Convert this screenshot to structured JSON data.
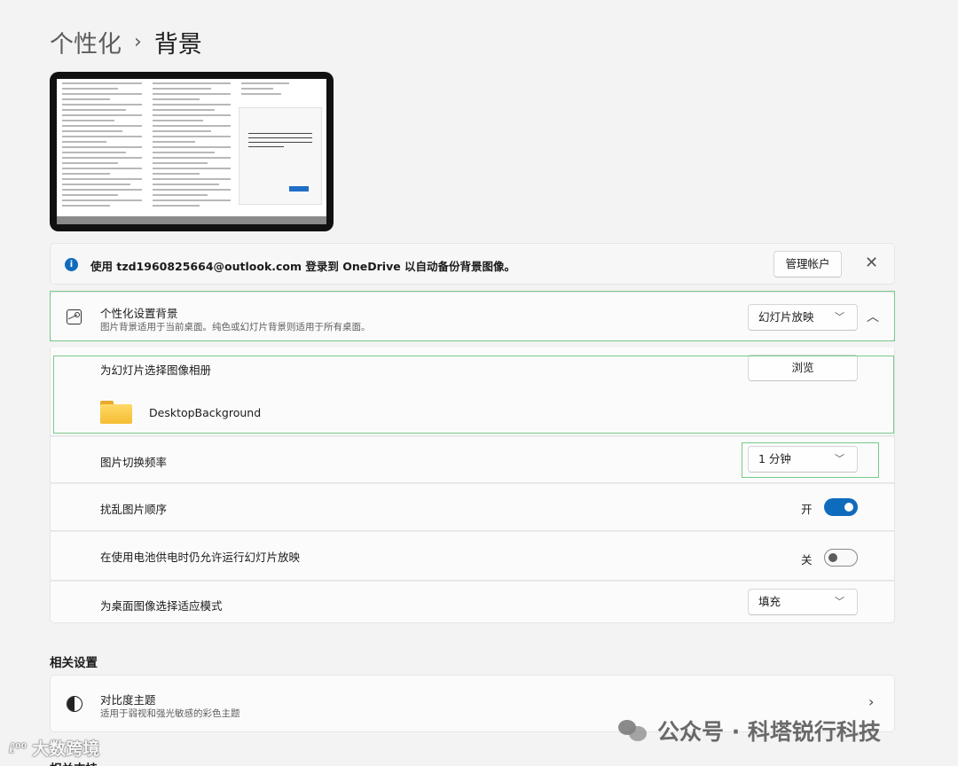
{
  "breadcrumb": {
    "parent": "个性化",
    "separator": "›",
    "current": "背景"
  },
  "banner": {
    "message": "使用 tzd1960825664@outlook.com 登录到 OneDrive 以自动备份背景图像。",
    "manage_button": "管理帐户",
    "close_glyph": "✕"
  },
  "personalize": {
    "title": "个性化设置背景",
    "subtitle": "图片背景适用于当前桌面。纯色或幻灯片背景则适用于所有桌面。",
    "selected": "幻灯片放映",
    "expanded": true
  },
  "album": {
    "label": "为幻灯片选择图像相册",
    "browse_button": "浏览",
    "folder_name": "DesktopBackground"
  },
  "frequency": {
    "label": "图片切换频率",
    "selected": "1 分钟"
  },
  "shuffle": {
    "label": "扰乱图片顺序",
    "state_label": "开",
    "on": true
  },
  "battery": {
    "label": "在使用电池供电时仍允许运行幻灯片放映",
    "state_label": "关",
    "on": false
  },
  "fit": {
    "label": "为桌面图像选择适应模式",
    "selected": "填充"
  },
  "related": {
    "heading": "相关设置",
    "contrast_title": "对比度主题",
    "contrast_subtitle": "适用于弱视和强光敏感的彩色主题"
  },
  "cut_heading": "相关支持",
  "watermarks": {
    "right": "公众号 · 科塔锐行科技",
    "left": "大数跨境",
    "left_logo": "ℓ⁰⁰"
  },
  "icons": {
    "info": "info-icon",
    "picture": "picture-icon",
    "chevron_down": "chevron-down-icon",
    "chevron_up": "chevron-up-icon",
    "folder": "folder-icon",
    "contrast": "contrast-icon",
    "chevron_right": "chevron-right-icon"
  },
  "colors": {
    "accent": "#0f6cbd",
    "highlight": "#79c98b",
    "background": "#f3f3f3",
    "folder": "#f5bd33"
  }
}
